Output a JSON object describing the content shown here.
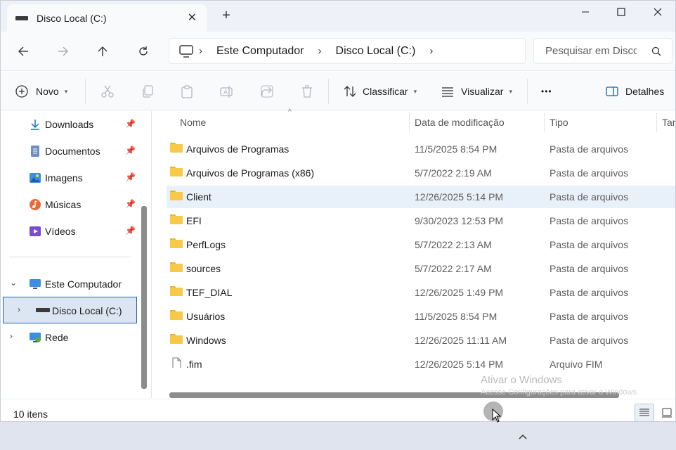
{
  "window": {
    "tab_title": "Disco Local (C:)",
    "tab_close_label": "✕",
    "new_tab_label": "+"
  },
  "navigation": {
    "breadcrumbs": [
      "Este Computador",
      "Disco Local (C:)"
    ],
    "search_placeholder": "Pesquisar em Disco"
  },
  "toolbar": {
    "new_label": "Novo",
    "sort_label": "Classificar",
    "view_label": "Visualizar",
    "more_label": "•••",
    "details_label": "Detalhes"
  },
  "sidebar": {
    "quick_access": [
      {
        "label": "Downloads",
        "icon": "download-icon"
      },
      {
        "label": "Documentos",
        "icon": "document-icon"
      },
      {
        "label": "Imagens",
        "icon": "image-icon"
      },
      {
        "label": "Músicas",
        "icon": "music-icon"
      },
      {
        "label": "Vídeos",
        "icon": "video-icon"
      }
    ],
    "this_pc": "Este Computador",
    "local_disk": "Disco Local (C:)",
    "network": "Rede"
  },
  "columns": {
    "name": "Nome",
    "date": "Data de modificação",
    "type": "Tipo",
    "size": "Tam"
  },
  "files": [
    {
      "name": "Arquivos de Programas",
      "date": "11/5/2025 8:54 PM",
      "type": "Pasta de arquivos",
      "kind": "folder"
    },
    {
      "name": "Arquivos de Programas (x86)",
      "date": "5/7/2022 2:19 AM",
      "type": "Pasta de arquivos",
      "kind": "folder"
    },
    {
      "name": "Client",
      "date": "12/26/2025 5:14 PM",
      "type": "Pasta de arquivos",
      "kind": "folder"
    },
    {
      "name": "EFI",
      "date": "9/30/2023 12:53 PM",
      "type": "Pasta de arquivos",
      "kind": "folder"
    },
    {
      "name": "PerfLogs",
      "date": "5/7/2022 2:13 AM",
      "type": "Pasta de arquivos",
      "kind": "folder"
    },
    {
      "name": "sources",
      "date": "5/7/2022 2:17 AM",
      "type": "Pasta de arquivos",
      "kind": "folder"
    },
    {
      "name": "TEF_DIAL",
      "date": "12/26/2025 1:49 PM",
      "type": "Pasta de arquivos",
      "kind": "folder"
    },
    {
      "name": "Usuários",
      "date": "11/5/2025 8:54 PM",
      "type": "Pasta de arquivos",
      "kind": "folder"
    },
    {
      "name": "Windows",
      "date": "12/26/2025 11:11 AM",
      "type": "Pasta de arquivos",
      "kind": "folder"
    },
    {
      "name": ".fim",
      "date": "12/26/2025 5:14 PM",
      "type": "Arquivo FIM",
      "kind": "file"
    }
  ],
  "status": {
    "item_count": "10 itens"
  },
  "watermark": {
    "line1": "Ativar o Windows",
    "line2": "Acesse Configurações para ativar o Windows."
  },
  "colors": {
    "accent": "#1a5fb4",
    "folder": "#f7c948",
    "selection": "#dce6f3",
    "hover_row": "#e8f0fa"
  }
}
